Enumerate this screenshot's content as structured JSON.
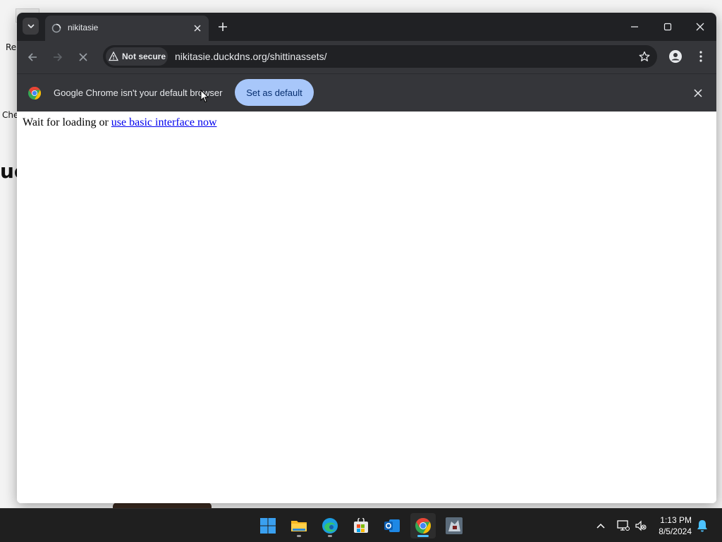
{
  "desktop": {
    "fragments": [
      "Re",
      "Che",
      "ue"
    ]
  },
  "browser": {
    "tab": {
      "title": "nikitasie"
    },
    "toolbar": {
      "security_label": "Not secure",
      "url": "nikitasie.duckdns.org/shittinassets/"
    },
    "infobar": {
      "message": "Google Chrome isn't your default browser",
      "button_label": "Set as default"
    },
    "content": {
      "prefix": "Wait for loading or ",
      "link_text": "use basic interface now"
    }
  },
  "taskbar": {
    "apps": [
      "start",
      "file-explorer",
      "edge",
      "microsoft-store",
      "outlook",
      "chrome",
      "game-app"
    ],
    "clock": {
      "time": "1:13 PM",
      "date": "8/5/2024"
    }
  },
  "colors": {
    "tabstrip": "#202124",
    "toolbar": "#35363a",
    "set_default_button": "#a8c7fa",
    "link": "#0000ee"
  }
}
